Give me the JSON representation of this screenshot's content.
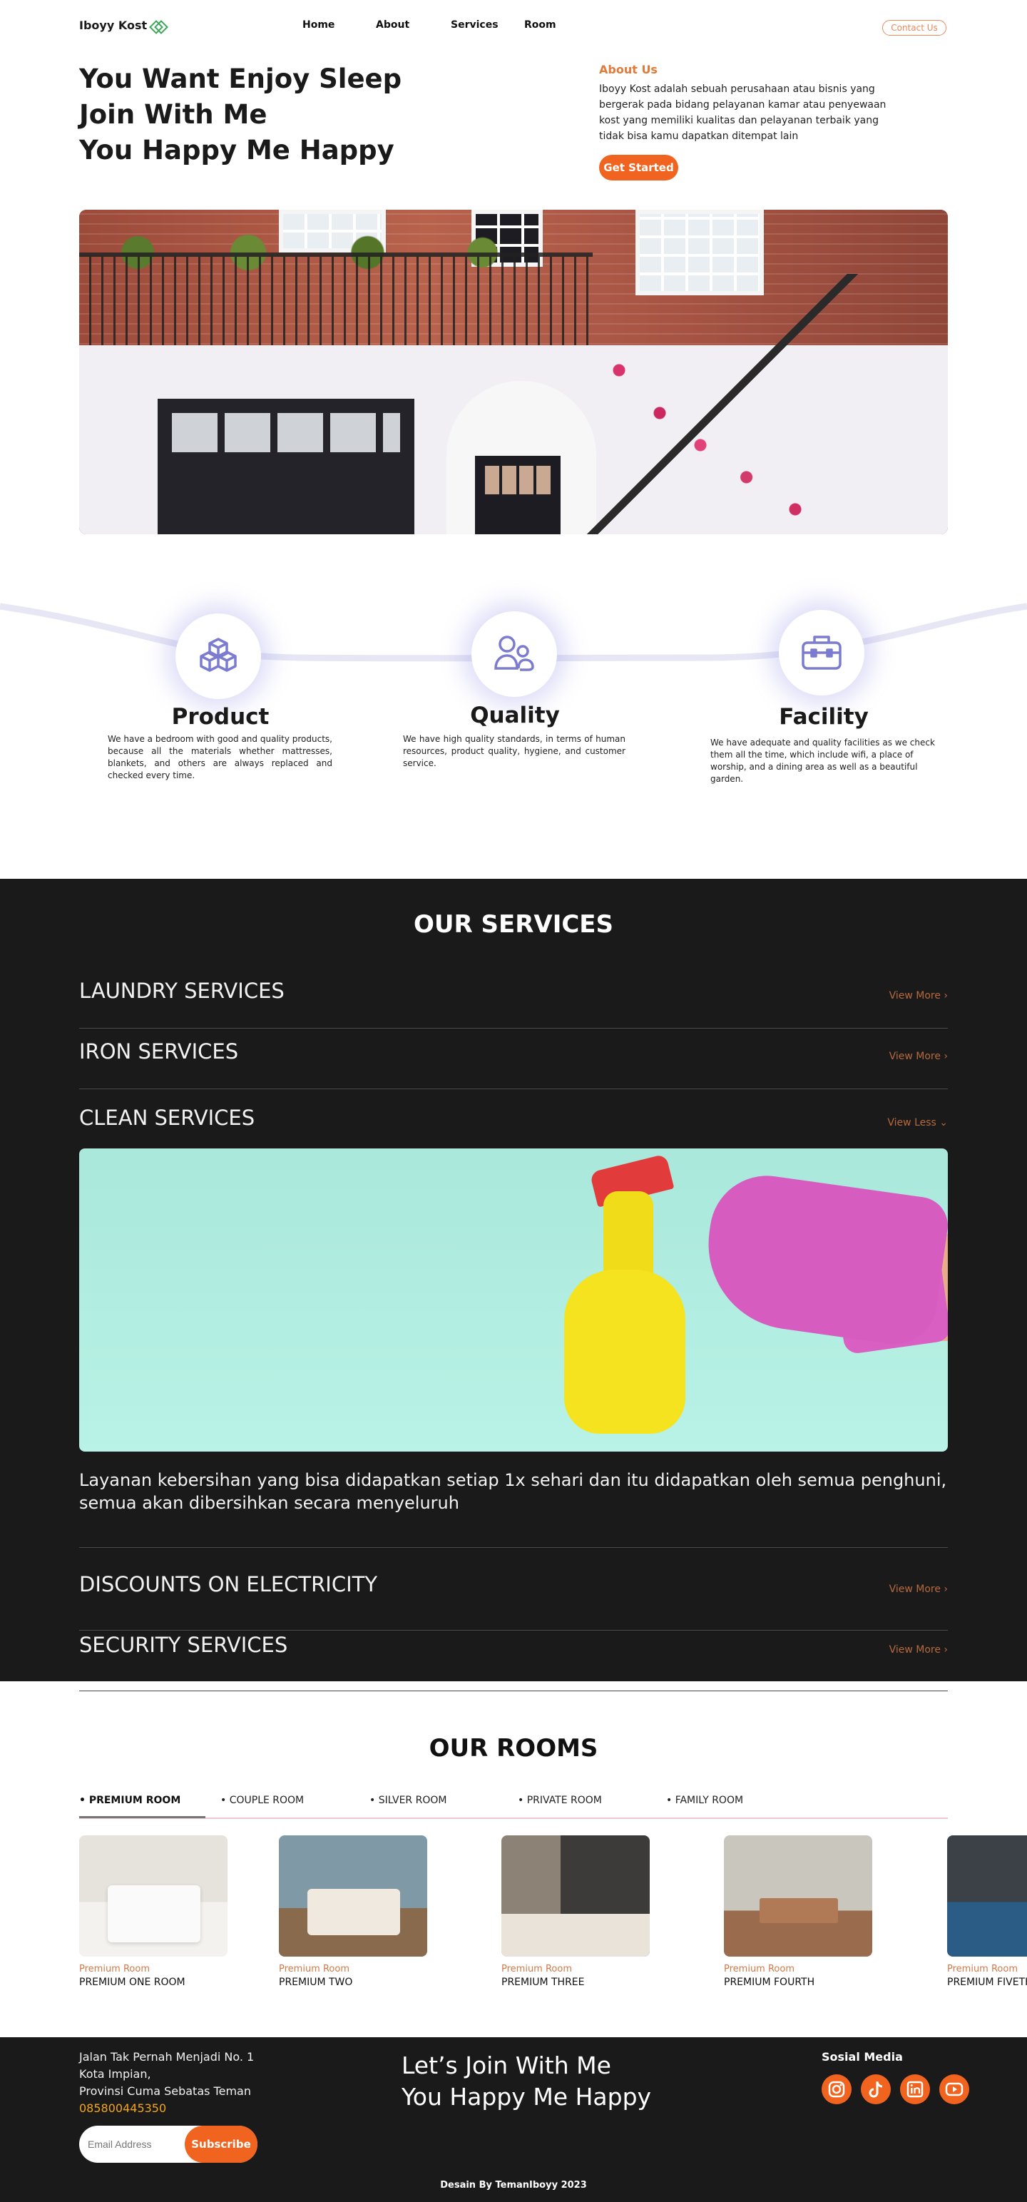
{
  "nav": {
    "brand": "Iboyy Kost",
    "links": [
      "Home",
      "About",
      "Services",
      "Room"
    ],
    "contact": "Contact Us"
  },
  "hero": {
    "lines": [
      "You Want Enjoy Sleep",
      "Join With Me",
      "You Happy Me Happy"
    ],
    "about_label": "About Us",
    "about_text": "Iboyy Kost adalah sebuah perusahaan atau bisnis yang bergerak pada bidang pelayanan kamar  atau penyewaan kost yang memiliki kualitas dan pelayanan terbaik yang tidak bisa kamu dapatkan ditempat lain",
    "cta": "Get Started"
  },
  "features": [
    {
      "title": "Product",
      "icon": "boxes-icon",
      "desc": "We have a bedroom with good and quality products, because all the materials whether mattresses, blankets, and others are always replaced and checked every time."
    },
    {
      "title": "Quality",
      "icon": "users-icon",
      "desc": "We have high quality standards, in terms of human resources, product quality, hygiene, and customer service."
    },
    {
      "title": "Facility",
      "icon": "toolbox-icon",
      "desc": "We have adequate and quality facilities as we check them all the time, which include wifi, a place of worship, and a dining area as well as a beautiful garden."
    }
  ],
  "services": {
    "title": "OUR SERVICES",
    "items": [
      {
        "name": "LAUNDRY SERVICES",
        "action": "View More ›"
      },
      {
        "name": "IRON SERVICES",
        "action": "View More ›"
      },
      {
        "name": "CLEAN SERVICES",
        "action": "View Less ⌄"
      },
      {
        "name": "DISCOUNTS  ON ELECTRICITY",
        "action": "View More ›"
      },
      {
        "name": "SECURITY SERVICES",
        "action": "View More ›"
      }
    ],
    "clean_text": "Layanan kebersihan yang bisa didapatkan setiap 1x sehari dan itu didapatkan oleh semua penghuni, semua akan dibersihkan secara menyeluruh"
  },
  "rooms": {
    "title": "OUR ROOMS",
    "tabs": [
      "• PREMIUM ROOM",
      "• COUPLE ROOM",
      "• SILVER ROOM",
      "• PRIVATE ROOM",
      "• FAMILY ROOM"
    ],
    "active_tab": 0,
    "items": [
      {
        "category": "Premium Room",
        "name": "PREMIUM ONE ROOM"
      },
      {
        "category": "Premium Room",
        "name": "PREMIUM TWO"
      },
      {
        "category": "Premium Room",
        "name": "PREMIUM THREE"
      },
      {
        "category": "Premium Room",
        "name": "PREMIUM FOURTH"
      },
      {
        "category": "Premium Room",
        "name": "PREMIUM FIVETH"
      }
    ]
  },
  "footer": {
    "address": [
      "Jalan Tak Pernah Menjadi No. 1",
      "Kota Impian,",
      "Provinsi Cuma Sebatas Teman"
    ],
    "phone": "085800445350",
    "email_placeholder": "Email Address",
    "subscribe": "Subscribe",
    "join": [
      "Let’s Join With Me",
      "You Happy Me Happy"
    ],
    "social_title": "Sosial Media",
    "social": [
      "instagram-icon",
      "tiktok-icon",
      "linkedin-icon",
      "youtube-icon"
    ],
    "credit": "Desain By TemanIboyy 2023"
  },
  "colors": {
    "accent": "#f0641f",
    "dark": "#1b1a1b",
    "about_label": "#e07b3a",
    "feature_icon": "#7b7bd0",
    "phone": "#f3a51a"
  }
}
